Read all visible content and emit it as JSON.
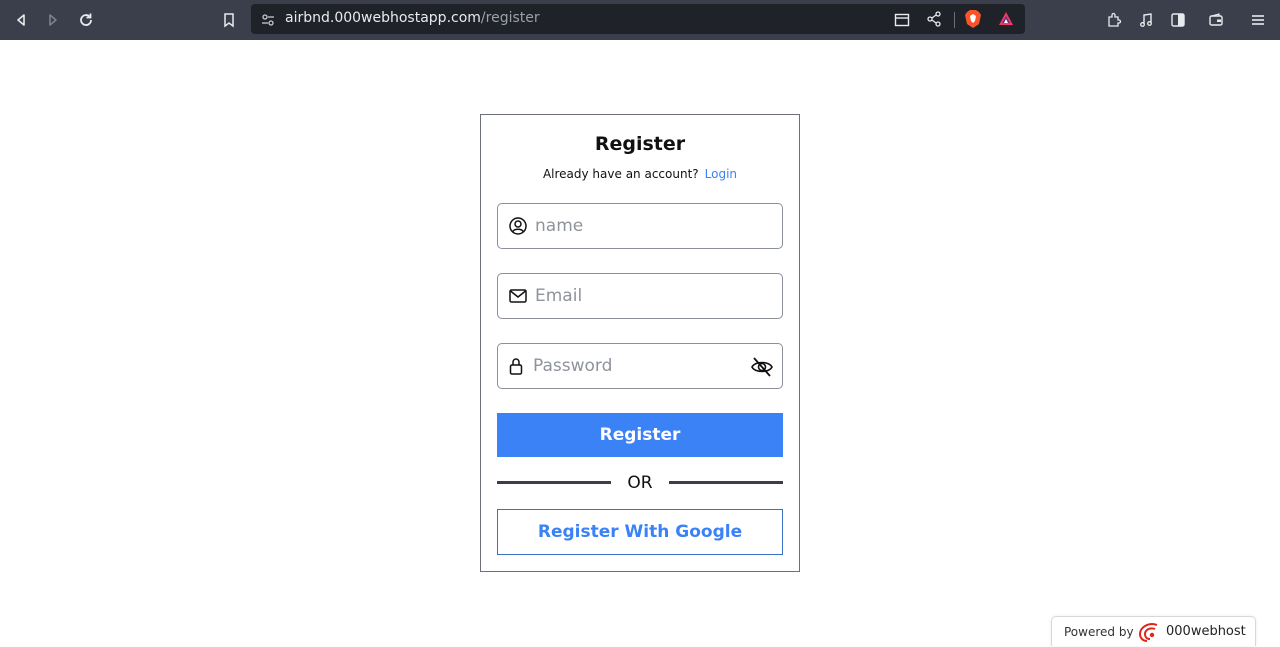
{
  "browser": {
    "url_host": "airbnd.000webhostapp.com",
    "url_path": "/register"
  },
  "form": {
    "title": "Register",
    "have_account_text": "Already have an account?",
    "login_link": "Login",
    "name_placeholder": "name",
    "email_placeholder": "Email",
    "password_placeholder": "Password",
    "register_button": "Register",
    "or_text": "OR",
    "google_button": "Register With Google"
  },
  "footer": {
    "powered_by": "Powered by",
    "brand": "000webhost"
  },
  "colors": {
    "accent": "#3b82f6",
    "toolbar": "#3a3f4b"
  }
}
